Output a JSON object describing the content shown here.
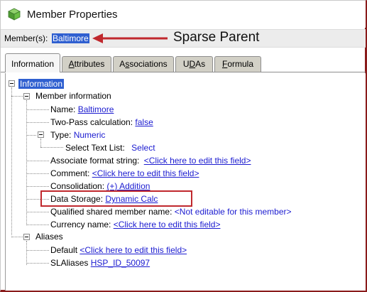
{
  "window": {
    "title": "Member Properties"
  },
  "member_bar": {
    "label": "Member(s):",
    "value": "Baltimore"
  },
  "annotation": {
    "text": "Sparse Parent",
    "arrow_color": "#c0282d"
  },
  "tabs": [
    {
      "label": "Information",
      "mnemonic": ""
    },
    {
      "label": "Attributes",
      "mnemonic": "A"
    },
    {
      "label": "Associations",
      "mnemonic": "s"
    },
    {
      "label": "UDAs",
      "mnemonic": "D"
    },
    {
      "label": "Formula",
      "mnemonic": "F"
    }
  ],
  "tree": {
    "root": "Information",
    "member_info": {
      "heading": "Member information",
      "name_label": "Name:",
      "name_value": "Baltimore",
      "two_pass_label": "Two-Pass calculation:",
      "two_pass_value": "false",
      "type_label": "Type:",
      "type_value": "Numeric",
      "select_text_label": "Select Text List:",
      "select_text_value": "Select",
      "format_label": "Associate format string:",
      "format_value": "<Click here to edit this field>",
      "comment_label": "Comment:",
      "comment_value": "<Click here to edit this field>",
      "consolidation_label": "Consolidation:",
      "consolidation_value": "(+) Addition",
      "storage_label": "Data Storage:",
      "storage_value": "Dynamic Calc",
      "shared_label": "Qualified shared member name:",
      "shared_value": "<Not editable for this member>",
      "currency_label": "Currency name:",
      "currency_value": "<Click here to edit this field>"
    },
    "aliases": {
      "heading": "Aliases",
      "default_label": "Default",
      "default_value": "<Click here to edit this field>",
      "sla_label": "SLAliases",
      "sla_value": "HSP_ID_50097"
    }
  },
  "colors": {
    "selection": "#2f5fd0",
    "link": "#1b1bd0",
    "highlight": "#c0282d",
    "frame": "#8a1b1b"
  }
}
